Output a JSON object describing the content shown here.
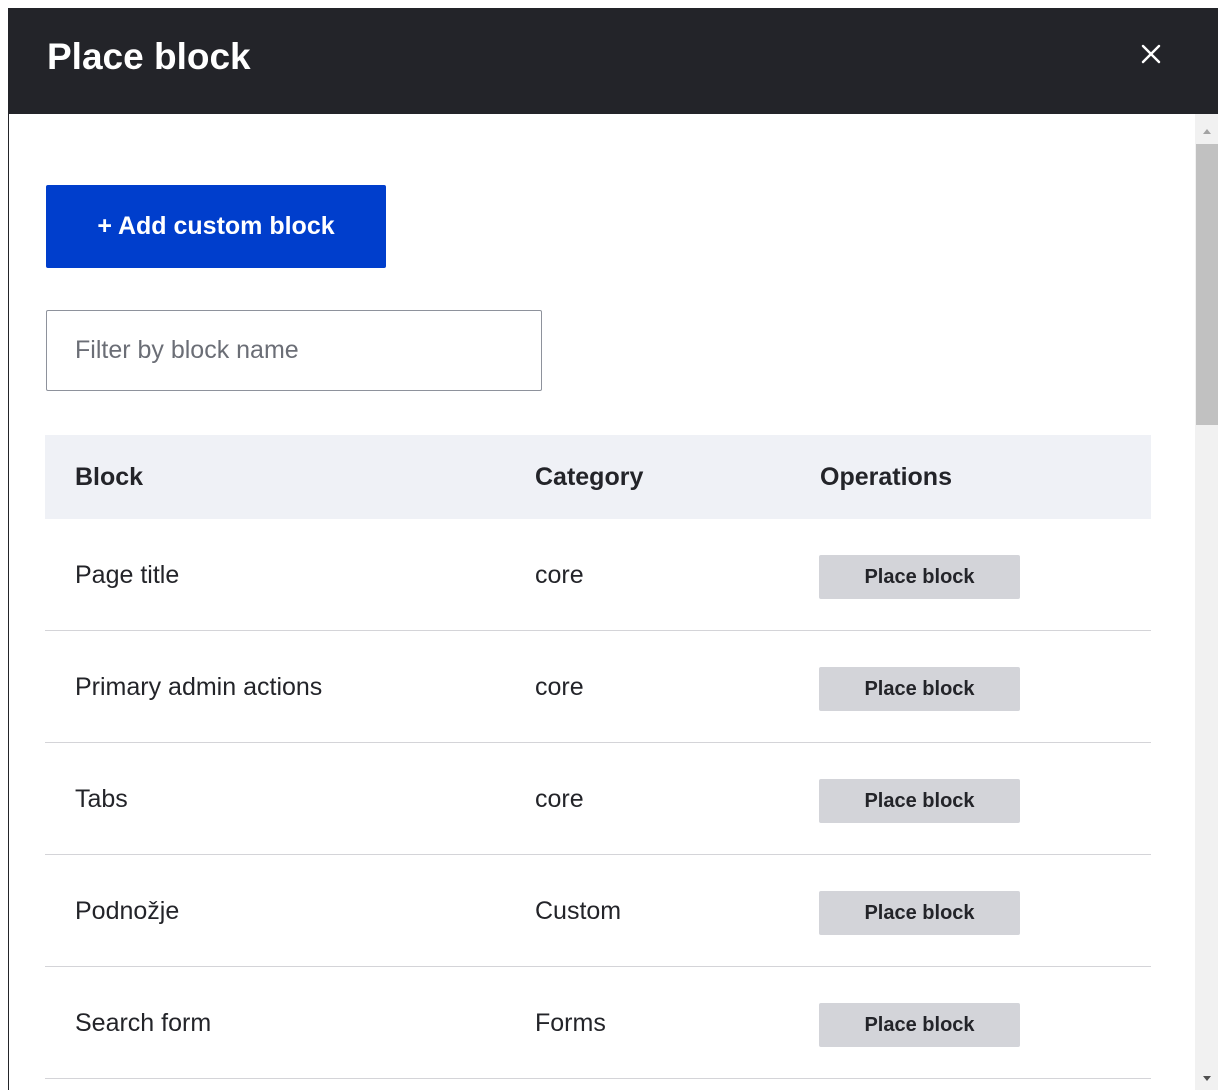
{
  "dialog": {
    "title": "Place block",
    "close_icon": "close-icon"
  },
  "actions": {
    "add_plus": "+",
    "add_label": "Add custom block"
  },
  "filter": {
    "placeholder": "Filter by block name",
    "value": ""
  },
  "table": {
    "headers": [
      "Block",
      "Category",
      "Operations"
    ],
    "rows": [
      {
        "block": "Page title",
        "category": "core",
        "operation": "Place block"
      },
      {
        "block": "Primary admin actions",
        "category": "core",
        "operation": "Place block"
      },
      {
        "block": "Tabs",
        "category": "core",
        "operation": "Place block"
      },
      {
        "block": "Podnožje",
        "category": "Custom",
        "operation": "Place block"
      },
      {
        "block": "Search form",
        "category": "Forms",
        "operation": "Place block"
      }
    ]
  },
  "colors": {
    "titlebar": "#232429",
    "primary_button": "#003ecc",
    "secondary_button": "#d3d4d9",
    "header_row": "#eff1f6"
  }
}
